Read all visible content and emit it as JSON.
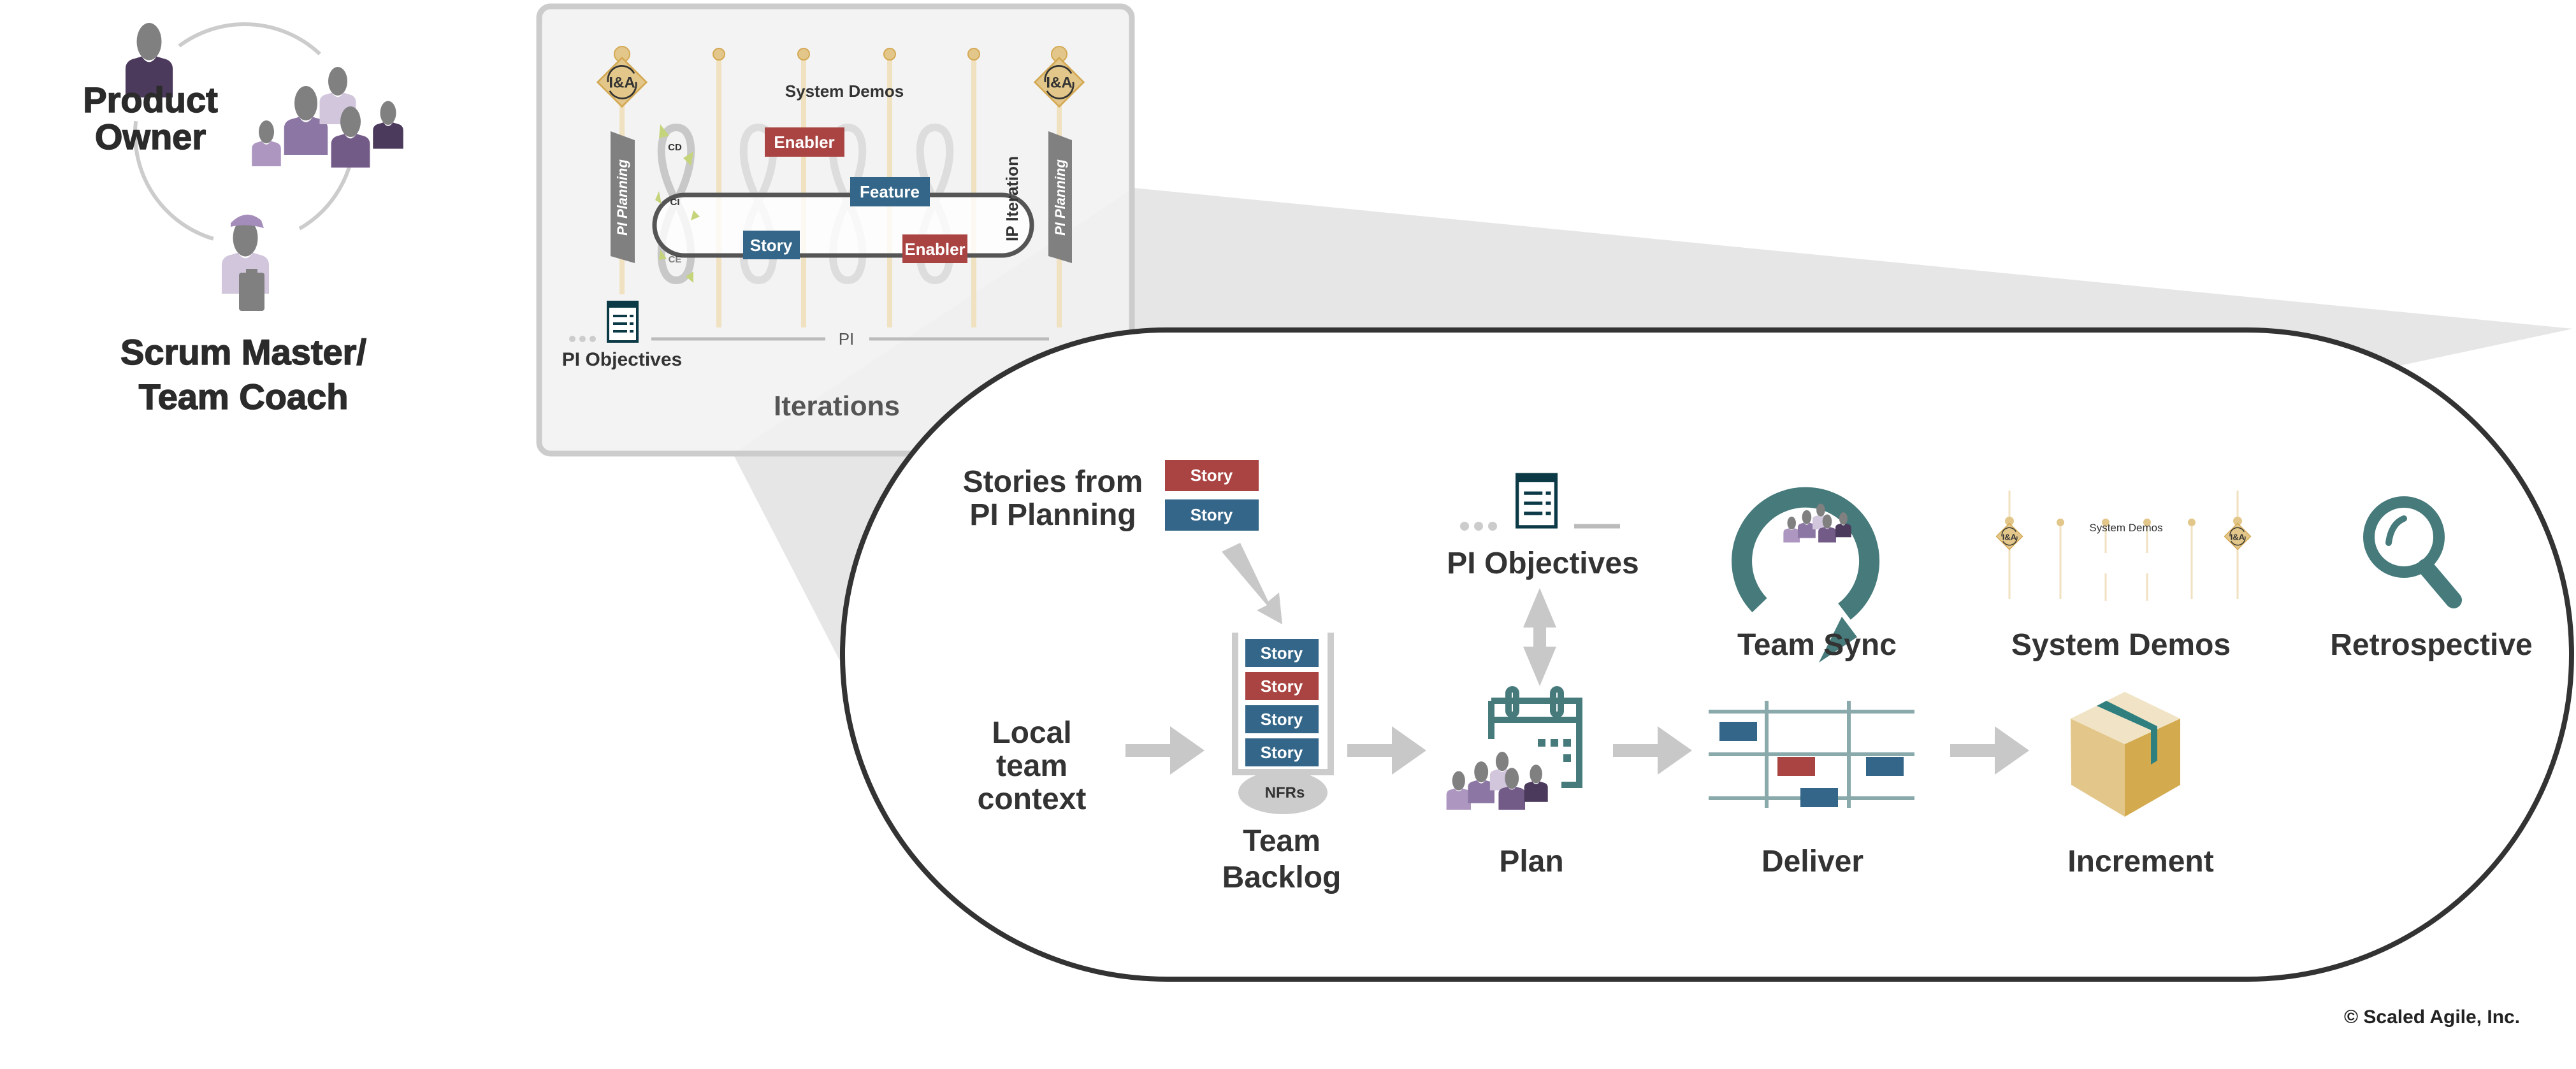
{
  "roles": {
    "product_owner": [
      "Product",
      "Owner"
    ],
    "scrum_master": [
      "Scrum Master/",
      "Team Coach"
    ]
  },
  "iterations_panel": {
    "title": "Iterations",
    "system_demos": "System Demos",
    "pi_planning_left": "PI Planning",
    "pi_planning_right": "PI Planning",
    "ip_iteration": "IP Iteration",
    "ia_badge": "I&A",
    "loop_labels": [
      "CD",
      "CI",
      "CE"
    ],
    "enabler_top": "Enabler",
    "feature": "Feature",
    "story": "Story",
    "enabler_bottom": "Enabler",
    "pi_objectives": "PI Objectives",
    "pi": "PI"
  },
  "iteration_detail": {
    "stories_from": [
      "Stories from",
      "PI Planning"
    ],
    "incoming_stories": [
      "Story",
      "Story"
    ],
    "local_context": [
      "Local",
      "team",
      "context"
    ],
    "backlog_stories": [
      "Story",
      "Story",
      "Story",
      "Story"
    ],
    "nfrs": "NFRs",
    "team_backlog": [
      "Team",
      "Backlog"
    ],
    "pi_objectives": "PI Objectives",
    "plan": "Plan",
    "deliver": "Deliver",
    "increment": "Increment",
    "team_sync": "Team Sync",
    "system_demos": "System Demos",
    "system_demos_mini": "System  Demos",
    "retrospective": "Retrospective"
  },
  "copyright": "© Scaled Agile, Inc.",
  "colors": {
    "story_red": "#a94442",
    "story_blue": "#336688",
    "teal": "#467a7b",
    "arrow_gray": "#c8c8c8",
    "gold": "#e3c78a",
    "purple_dark": "#4b3a5c",
    "purple_mid": "#8c76a3"
  }
}
